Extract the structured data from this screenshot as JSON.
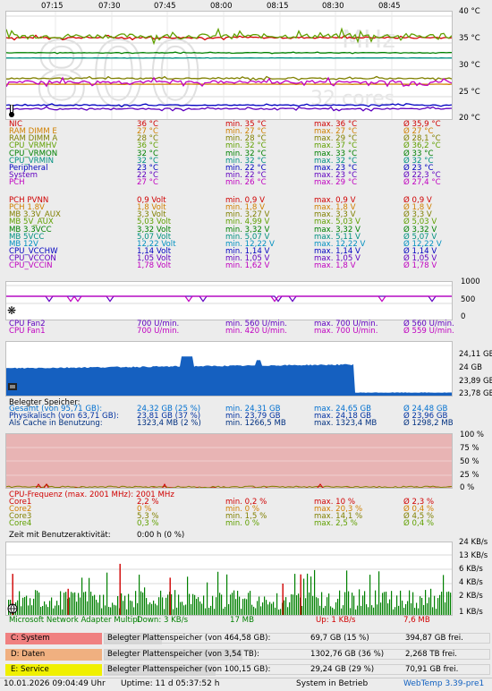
{
  "time_axis": [
    "07:15",
    "07:30",
    "07:45",
    "08:00",
    "08:15",
    "08:30",
    "08:45"
  ],
  "temp_axis": [
    "40 °C",
    "35 °C",
    "30 °C",
    "25 °C",
    "20 °C"
  ],
  "temp_bg": {
    "main": "800",
    "unit": "MHz",
    "cores": "32 cores"
  },
  "sensors": [
    {
      "name": "NIC",
      "cur": "36 °C",
      "min": "min. 35 °C",
      "max": "max. 36 °C",
      "avg": "Ø 35,9 °C",
      "color": "#d00000"
    },
    {
      "name": "RAM DIMM E",
      "cur": "27 °C",
      "min": "min. 27 °C",
      "max": "max. 27 °C",
      "avg": "Ø 27 °C",
      "color": "#d08000"
    },
    {
      "name": "RAM DIMM A",
      "cur": "28 °C",
      "min": "min. 28 °C",
      "max": "max. 29 °C",
      "avg": "Ø 28,1 °C",
      "color": "#808000"
    },
    {
      "name": "CPU_VRMHV",
      "cur": "36 °C",
      "min": "min. 32 °C",
      "max": "max. 37 °C",
      "avg": "Ø 36,2 °C",
      "color": "#60a000"
    },
    {
      "name": "CPU_VRMON",
      "cur": "32 °C",
      "min": "min. 32 °C",
      "max": "max. 33 °C",
      "avg": "Ø 33 °C",
      "color": "#008000"
    },
    {
      "name": "CPU_VRMIN",
      "cur": "32 °C",
      "min": "min. 32 °C",
      "max": "max. 32 °C",
      "avg": "Ø 32 °C",
      "color": "#009080"
    },
    {
      "name": "Peripheral",
      "cur": "23 °C",
      "min": "min. 22 °C",
      "max": "max. 23 °C",
      "avg": "Ø 23 °C",
      "color": "#0000c0"
    },
    {
      "name": "System",
      "cur": "22 °C",
      "min": "min. 22 °C",
      "max": "max. 23 °C",
      "avg": "Ø 22,3 °C",
      "color": "#6000c0"
    },
    {
      "name": "PCH",
      "cur": "27 °C",
      "min": "min. 26 °C",
      "max": "max. 29 °C",
      "avg": "Ø 27,4 °C",
      "color": "#c000c0"
    }
  ],
  "voltages": [
    {
      "name": "PCH PVNN",
      "cur": "0,9 Volt",
      "min": "min. 0,9 V",
      "max": "max. 0,9 V",
      "avg": "Ø 0,9 V",
      "color": "#d00000"
    },
    {
      "name": "PCH 1.8V",
      "cur": "1,8 Volt",
      "min": "min. 1,8 V",
      "max": "max. 1,8 V",
      "avg": "Ø 1,8 V",
      "color": "#d08000"
    },
    {
      "name": "MB 3.3V_AUX",
      "cur": "3,3 Volt",
      "min": "min. 3,27 V",
      "max": "max. 3,3 V",
      "avg": "Ø 3,3 V",
      "color": "#808000"
    },
    {
      "name": "MB 5V_AUX",
      "cur": "5,03 Volt",
      "min": "min. 4,99 V",
      "max": "max. 5,03 V",
      "avg": "Ø 5,03 V",
      "color": "#60a000"
    },
    {
      "name": "MB 3.3VCC",
      "cur": "3,32 Volt",
      "min": "min. 3,32 V",
      "max": "max. 3,32 V",
      "avg": "Ø 3,32 V",
      "color": "#008000"
    },
    {
      "name": "MB 5VCC",
      "cur": "5,07 Volt",
      "min": "min. 5,07 V",
      "max": "max. 5,11 V",
      "avg": "Ø 5,07 V",
      "color": "#009080"
    },
    {
      "name": "MB 12V",
      "cur": "12,22 Volt",
      "min": "min. 12,22 V",
      "max": "max. 12,22 V",
      "avg": "Ø 12,22 V",
      "color": "#0090c0"
    },
    {
      "name": "CPU_VCCHW",
      "cur": "1,14 Volt",
      "min": "min. 1,14 V",
      "max": "max. 1,14 V",
      "avg": "Ø 1,14 V",
      "color": "#0000c0"
    },
    {
      "name": "CPU_VCCON",
      "cur": "1,05 Volt",
      "min": "min. 1,05 V",
      "max": "max. 1,05 V",
      "avg": "Ø 1,05 V",
      "color": "#6000c0"
    },
    {
      "name": "CPU_VCCIN",
      "cur": "1,78 Volt",
      "min": "min. 1,62 V",
      "max": "max. 1,8 V",
      "avg": "Ø 1,78 V",
      "color": "#c000c0"
    }
  ],
  "fan_axis": [
    "1000",
    "500",
    "0"
  ],
  "fans": [
    {
      "name": "CPU Fan2",
      "cur": "700 U/min.",
      "min": "min. 560 U/min.",
      "max": "max. 700 U/min.",
      "avg": "Ø 560 U/min.",
      "color": "#6000c0"
    },
    {
      "name": "CPU Fan1",
      "cur": "700 U/min.",
      "min": "min. 420 U/min.",
      "max": "max. 700 U/min.",
      "avg": "Ø 559 U/min.",
      "color": "#c000c0"
    }
  ],
  "mem_axis": [
    "24,11 GB",
    "24 GB",
    "23,89 GB",
    "23,78 GB"
  ],
  "memory": {
    "title": "Belegter Speicher:",
    "rows": [
      {
        "name": "Gesamt (von 95,71 GB):",
        "cur": "24,32 GB (25 %)",
        "min": "min. 24,31 GB",
        "max": "max. 24,65 GB",
        "avg": "Ø 24,48 GB",
        "color": "#0070d0"
      },
      {
        "name": "Physikalisch (von 63,71 GB):",
        "cur": "23,81 GB (37 %)",
        "min": "min. 23,79 GB",
        "max": "max. 24,18 GB",
        "avg": "Ø 23,96 GB",
        "color": "#0030a0"
      },
      {
        "name": "Als Cache in Benutzung:",
        "cur": "1323,4 MB (2 %)",
        "min": "min. 1266,5 MB",
        "max": "max. 1323,4 MB",
        "avg": "Ø 1298,2 MB",
        "color": "#003080"
      }
    ]
  },
  "cpu_axis": [
    "100 %",
    "75 %",
    "50 %",
    "25 %",
    "0 %"
  ],
  "cpu": {
    "freq": "CPU-Frequenz (max. 2001 MHz): 2001 MHz",
    "rows": [
      {
        "name": "Core1",
        "cur": "2,2 %",
        "min": "min. 0,2 %",
        "max": "max. 10 %",
        "avg": "Ø 2,3 %",
        "color": "#d00000"
      },
      {
        "name": "Core2",
        "cur": "0 %",
        "min": "min. 0 %",
        "max": "max. 20,3 %",
        "avg": "Ø 0,4 %",
        "color": "#d08000"
      },
      {
        "name": "Core3",
        "cur": "5,3 %",
        "min": "min. 1,5 %",
        "max": "max. 14,1 %",
        "avg": "Ø 4,5 %",
        "color": "#808000"
      },
      {
        "name": "Core4",
        "cur": "0,3 %",
        "min": "min. 0 %",
        "max": "max. 2,5 %",
        "avg": "Ø 0,4 %",
        "color": "#60a000"
      }
    ],
    "idle_label": "Zeit mit Benutzeraktivität:",
    "idle_value": "0:00 h (0 %)"
  },
  "net_axis": [
    "24 KB/s",
    "13 KB/s",
    "6 KB/s",
    "4 KB/s",
    "2 KB/s",
    "1 KB/s"
  ],
  "network": {
    "adapter": "Microsoft Network Adapter Multipl",
    "down": "Down: 3 KB/s",
    "down_total": "17 MB",
    "up": "Up: 1 KB/s",
    "up_total": "7,6 MB",
    "down_color": "#008000",
    "up_color": "#d00000"
  },
  "disks": [
    {
      "label": "C: System",
      "desc": "Belegter Plattenspeicher (von 464,58 GB):",
      "used": "69,7 GB (15 %)",
      "free": "394,87 GB frei.",
      "fill": 0.15,
      "color": "#f08080"
    },
    {
      "label": "D: Daten",
      "desc": "Belegter Plattenspeicher (von 3,54 TB):",
      "used": "1302,76 GB (36 %)",
      "free": "2,268 TB frei.",
      "fill": 0.36,
      "color": "#f0b080"
    },
    {
      "label": "E: Service",
      "desc": "Belegter Plattenspeicher (von 100,15 GB):",
      "used": "29,24 GB (29 %)",
      "free": "70,91 GB frei.",
      "fill": 0.29,
      "color": "#f0f000"
    }
  ],
  "status": {
    "datetime": "10.01.2026 09:04:49 Uhr",
    "uptime": "Uptime: 11 d 05:37:52 h",
    "state": "System in Betrieb",
    "version": "WebTemp 3.39-pre1"
  }
}
